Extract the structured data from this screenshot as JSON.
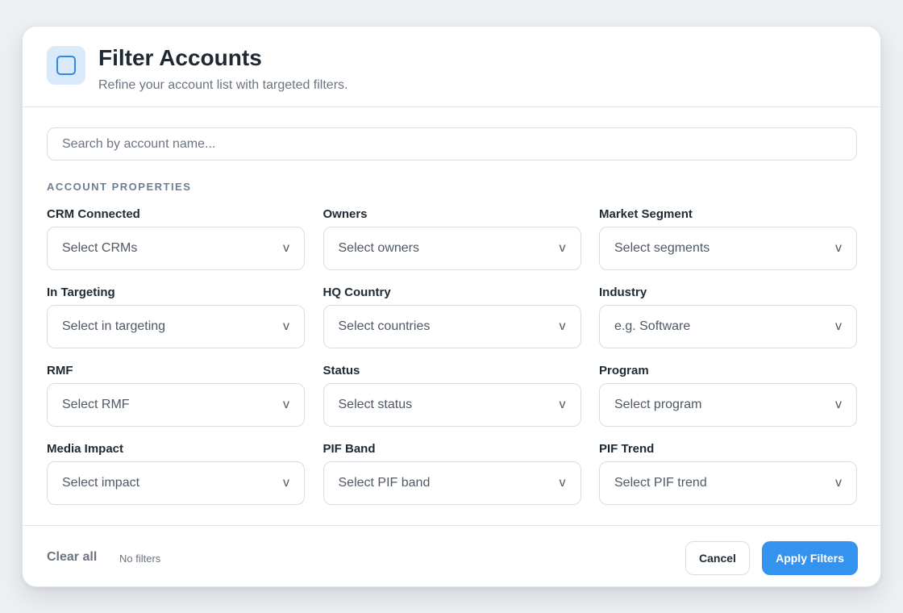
{
  "header": {
    "icon": "filter-square-icon",
    "title": "Filter Accounts",
    "subtitle": "Refine your account list with targeted filters."
  },
  "search": {
    "placeholder": "Search by account name...",
    "value": ""
  },
  "section": {
    "label": "ACCOUNT PROPERTIES"
  },
  "filters": [
    {
      "label": "CRM Connected",
      "placeholder": "Select CRMs"
    },
    {
      "label": "Owners",
      "placeholder": "Select owners"
    },
    {
      "label": "Market Segment",
      "placeholder": "Select segments"
    },
    {
      "label": "In Targeting",
      "placeholder": "Select in targeting"
    },
    {
      "label": "HQ Country",
      "placeholder": "Select countries"
    },
    {
      "label": "Industry",
      "placeholder": "e.g. Software"
    },
    {
      "label": "RMF",
      "placeholder": "Select RMF"
    },
    {
      "label": "Status",
      "placeholder": "Select status"
    },
    {
      "label": "Program",
      "placeholder": "Select program"
    },
    {
      "label": "Media Impact",
      "placeholder": "Select impact"
    },
    {
      "label": "PIF Band",
      "placeholder": "Select PIF band"
    },
    {
      "label": "PIF Trend",
      "placeholder": "Select PIF trend"
    }
  ],
  "chevron": "v",
  "footer": {
    "clear_label": "Clear all",
    "filter_count": "No filters",
    "cancel_label": "Cancel",
    "apply_label": "Apply Filters"
  },
  "colors": {
    "accent": "#3593f0",
    "icon_bg": "#dbeafb"
  }
}
